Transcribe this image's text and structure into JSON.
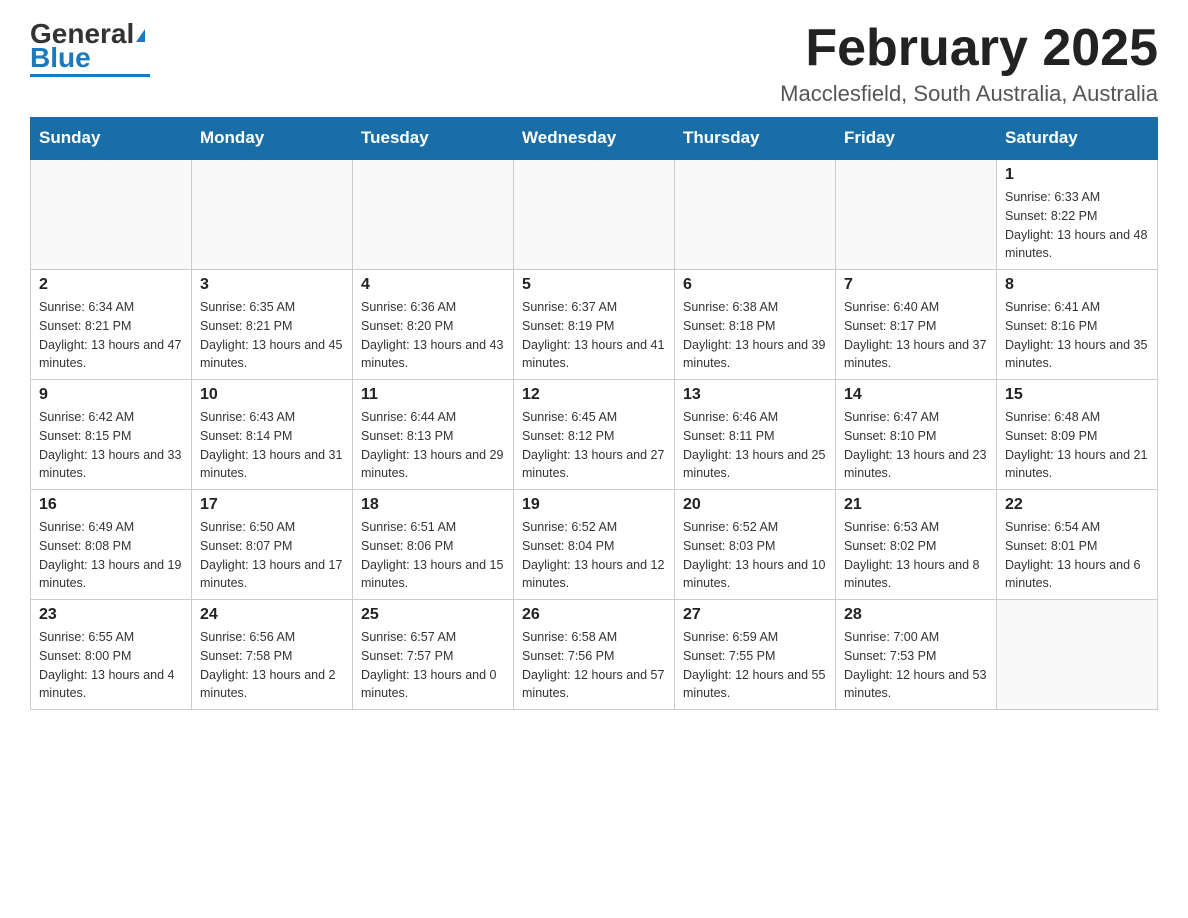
{
  "header": {
    "logo_general": "General",
    "logo_blue": "Blue",
    "title": "February 2025",
    "subtitle": "Macclesfield, South Australia, Australia"
  },
  "days_of_week": [
    "Sunday",
    "Monday",
    "Tuesday",
    "Wednesday",
    "Thursday",
    "Friday",
    "Saturday"
  ],
  "weeks": [
    [
      {
        "day": "",
        "info": ""
      },
      {
        "day": "",
        "info": ""
      },
      {
        "day": "",
        "info": ""
      },
      {
        "day": "",
        "info": ""
      },
      {
        "day": "",
        "info": ""
      },
      {
        "day": "",
        "info": ""
      },
      {
        "day": "1",
        "info": "Sunrise: 6:33 AM\nSunset: 8:22 PM\nDaylight: 13 hours and 48 minutes."
      }
    ],
    [
      {
        "day": "2",
        "info": "Sunrise: 6:34 AM\nSunset: 8:21 PM\nDaylight: 13 hours and 47 minutes."
      },
      {
        "day": "3",
        "info": "Sunrise: 6:35 AM\nSunset: 8:21 PM\nDaylight: 13 hours and 45 minutes."
      },
      {
        "day": "4",
        "info": "Sunrise: 6:36 AM\nSunset: 8:20 PM\nDaylight: 13 hours and 43 minutes."
      },
      {
        "day": "5",
        "info": "Sunrise: 6:37 AM\nSunset: 8:19 PM\nDaylight: 13 hours and 41 minutes."
      },
      {
        "day": "6",
        "info": "Sunrise: 6:38 AM\nSunset: 8:18 PM\nDaylight: 13 hours and 39 minutes."
      },
      {
        "day": "7",
        "info": "Sunrise: 6:40 AM\nSunset: 8:17 PM\nDaylight: 13 hours and 37 minutes."
      },
      {
        "day": "8",
        "info": "Sunrise: 6:41 AM\nSunset: 8:16 PM\nDaylight: 13 hours and 35 minutes."
      }
    ],
    [
      {
        "day": "9",
        "info": "Sunrise: 6:42 AM\nSunset: 8:15 PM\nDaylight: 13 hours and 33 minutes."
      },
      {
        "day": "10",
        "info": "Sunrise: 6:43 AM\nSunset: 8:14 PM\nDaylight: 13 hours and 31 minutes."
      },
      {
        "day": "11",
        "info": "Sunrise: 6:44 AM\nSunset: 8:13 PM\nDaylight: 13 hours and 29 minutes."
      },
      {
        "day": "12",
        "info": "Sunrise: 6:45 AM\nSunset: 8:12 PM\nDaylight: 13 hours and 27 minutes."
      },
      {
        "day": "13",
        "info": "Sunrise: 6:46 AM\nSunset: 8:11 PM\nDaylight: 13 hours and 25 minutes."
      },
      {
        "day": "14",
        "info": "Sunrise: 6:47 AM\nSunset: 8:10 PM\nDaylight: 13 hours and 23 minutes."
      },
      {
        "day": "15",
        "info": "Sunrise: 6:48 AM\nSunset: 8:09 PM\nDaylight: 13 hours and 21 minutes."
      }
    ],
    [
      {
        "day": "16",
        "info": "Sunrise: 6:49 AM\nSunset: 8:08 PM\nDaylight: 13 hours and 19 minutes."
      },
      {
        "day": "17",
        "info": "Sunrise: 6:50 AM\nSunset: 8:07 PM\nDaylight: 13 hours and 17 minutes."
      },
      {
        "day": "18",
        "info": "Sunrise: 6:51 AM\nSunset: 8:06 PM\nDaylight: 13 hours and 15 minutes."
      },
      {
        "day": "19",
        "info": "Sunrise: 6:52 AM\nSunset: 8:04 PM\nDaylight: 13 hours and 12 minutes."
      },
      {
        "day": "20",
        "info": "Sunrise: 6:52 AM\nSunset: 8:03 PM\nDaylight: 13 hours and 10 minutes."
      },
      {
        "day": "21",
        "info": "Sunrise: 6:53 AM\nSunset: 8:02 PM\nDaylight: 13 hours and 8 minutes."
      },
      {
        "day": "22",
        "info": "Sunrise: 6:54 AM\nSunset: 8:01 PM\nDaylight: 13 hours and 6 minutes."
      }
    ],
    [
      {
        "day": "23",
        "info": "Sunrise: 6:55 AM\nSunset: 8:00 PM\nDaylight: 13 hours and 4 minutes."
      },
      {
        "day": "24",
        "info": "Sunrise: 6:56 AM\nSunset: 7:58 PM\nDaylight: 13 hours and 2 minutes."
      },
      {
        "day": "25",
        "info": "Sunrise: 6:57 AM\nSunset: 7:57 PM\nDaylight: 13 hours and 0 minutes."
      },
      {
        "day": "26",
        "info": "Sunrise: 6:58 AM\nSunset: 7:56 PM\nDaylight: 12 hours and 57 minutes."
      },
      {
        "day": "27",
        "info": "Sunrise: 6:59 AM\nSunset: 7:55 PM\nDaylight: 12 hours and 55 minutes."
      },
      {
        "day": "28",
        "info": "Sunrise: 7:00 AM\nSunset: 7:53 PM\nDaylight: 12 hours and 53 minutes."
      },
      {
        "day": "",
        "info": ""
      }
    ]
  ]
}
